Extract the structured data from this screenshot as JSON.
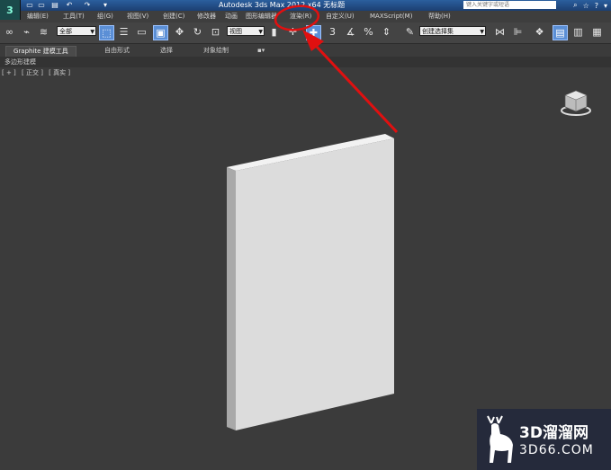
{
  "titlebar": {
    "logo": "3",
    "title": "Autodesk 3ds Max  2012 x64      无标题",
    "search_placeholder": "键入关键字或短语",
    "quick_access": [
      "▭",
      "▭",
      "▤",
      "↶",
      "↷",
      "▾"
    ],
    "right_icons": [
      "⌕",
      "☆",
      "?",
      "▾"
    ]
  },
  "menubar": {
    "items": [
      "编辑(E)",
      "工具(T)",
      "组(G)",
      "视图(V)",
      "创建(C)",
      "修改器",
      "动画",
      "图形编辑器",
      "渲染(R)",
      "自定义(U)",
      "MAXScript(M)",
      "帮助(H)"
    ]
  },
  "toolbar": {
    "selection_filter": "全部",
    "ref_coord": "视图",
    "named_selection": "创建选择集",
    "snap_label": "3"
  },
  "ribbon": {
    "tabs": [
      "Graphite 建模工具",
      "自由形式",
      "选择",
      "对象绘制"
    ],
    "extra": "▪▾"
  },
  "subpanel": {
    "label": "多边形建模"
  },
  "viewport": {
    "labels": [
      "[ + ]",
      "[ 正交 ]",
      "[ 真实 ]"
    ]
  },
  "watermark": {
    "brand": "3D溜溜网",
    "url": "3D66.COM"
  },
  "colors": {
    "titlebar": "#1c3f72",
    "viewport": "#3b3b3b",
    "annotation": "#e01010",
    "active_tool": "#5b8fd6"
  }
}
